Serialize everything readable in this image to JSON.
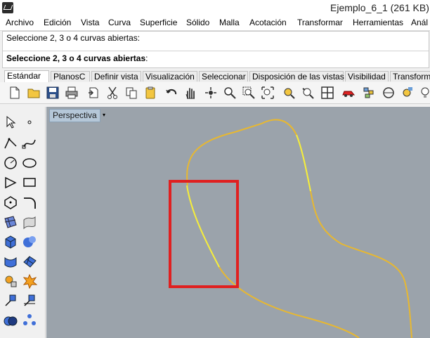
{
  "window": {
    "title": "Ejemplo_6_1 (261 KB)"
  },
  "menu": [
    "Archivo",
    "Edición",
    "Vista",
    "Curva",
    "Superficie",
    "Sólido",
    "Malla",
    "Acotación",
    "Transformar",
    "Herramientas",
    "Anál"
  ],
  "command": {
    "history": "Seleccione 2, 3 o 4 curvas abiertas:",
    "prompt": "Seleccione 2, 3 o 4 curvas abiertas",
    "prompt_suffix": ":"
  },
  "tabs": [
    "Estándar",
    "PlanosC",
    "Definir vista",
    "Visualización",
    "Seleccionar",
    "Disposición de las vistas",
    "Visibilidad",
    "Transform"
  ],
  "active_tab": "Estándar",
  "toolbar_icons": [
    "new-file-icon",
    "open-folder-icon",
    "save-icon",
    "print-icon",
    "import-icon",
    "cut-icon",
    "copy-icon",
    "paste-icon",
    "undo-icon",
    "pan-hand-icon",
    "rotate-view-icon",
    "zoom-icon",
    "zoom-window-icon",
    "zoom-extents-icon",
    "zoom-selected-icon",
    "rotate-camera-icon",
    "four-viewports-icon",
    "car-render-icon",
    "layers-icon",
    "osnap-icon",
    "properties-icon",
    "light-icon"
  ],
  "sidebar_icons": [
    "select-arrow-icon",
    "point-icon",
    "polyline-icon",
    "curve-icon",
    "circle-icon",
    "ellipse-icon",
    "arc-icon",
    "rectangle-icon",
    "polygon-icon",
    "fillet-icon",
    "surface-edge-icon",
    "surface-patch-icon",
    "box-icon",
    "sphere-icon",
    "extrude-icon",
    "mesh-icon",
    "gear-transform-icon",
    "explode-icon",
    "split-icon",
    "trim-icon",
    "boolean-union-icon",
    "array-icon"
  ],
  "viewport": {
    "label": "Perspectiva",
    "menu_arrow": "▾",
    "background": "#9ba3ab",
    "curve_color": "#e8b830",
    "highlight_color": "#f3ee40",
    "annotation_color": "#e02020"
  }
}
